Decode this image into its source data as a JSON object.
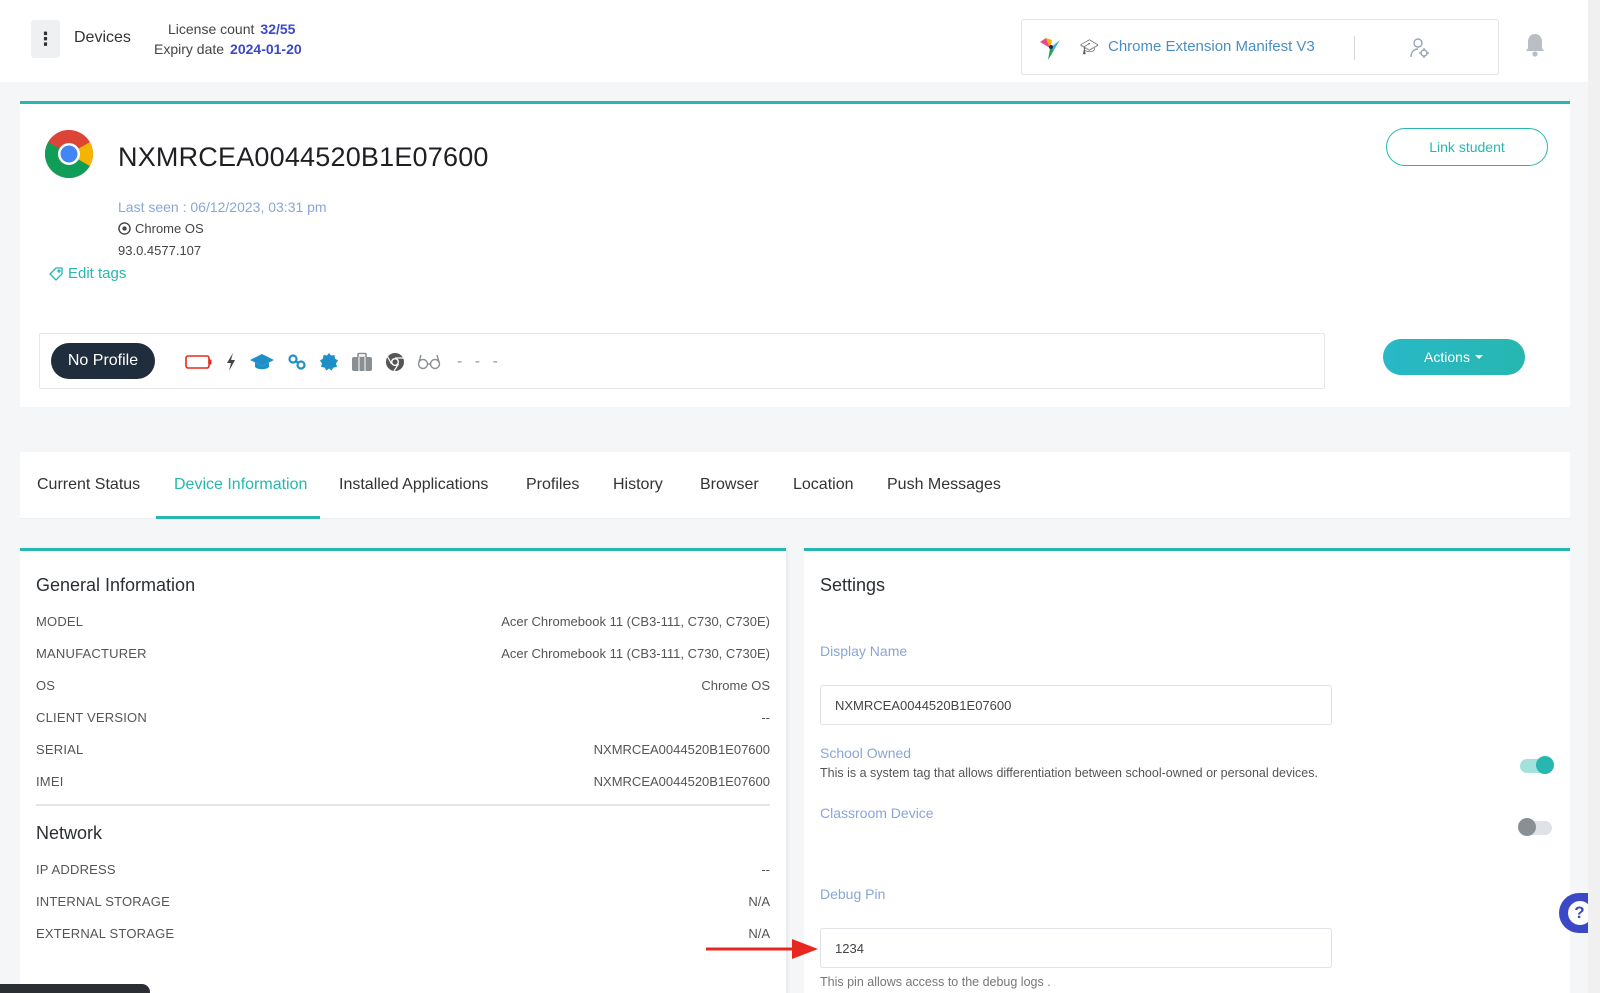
{
  "header": {
    "page_label": "Devices",
    "license_label": "License count",
    "license_value": "32/55",
    "expiry_label": "Expiry date",
    "expiry_value": "2024-01-20",
    "org_name": "Chrome Extension Manifest V3"
  },
  "device": {
    "title": "NXMRCEA0044520B1E07600",
    "last_seen": "Last seen : 06/12/2023, 03:31 pm",
    "os": "Chrome OS",
    "version": "93.0.4577.107",
    "edit_tags": "Edit tags",
    "link_student": "Link student",
    "profile": "No Profile",
    "status_dashes": "- - -",
    "actions": "Actions"
  },
  "tabs": [
    {
      "label": "Current Status"
    },
    {
      "label": "Device Information"
    },
    {
      "label": "Installed Applications"
    },
    {
      "label": "Profiles"
    },
    {
      "label": "History"
    },
    {
      "label": "Browser"
    },
    {
      "label": "Location"
    },
    {
      "label": "Push Messages"
    }
  ],
  "general": {
    "title": "General Information",
    "rows": [
      {
        "k": "MODEL",
        "v": "Acer Chromebook 11 (CB3-111, C730, C730E)"
      },
      {
        "k": "MANUFACTURER",
        "v": "Acer Chromebook 11 (CB3-111, C730, C730E)"
      },
      {
        "k": "OS",
        "v": "Chrome OS"
      },
      {
        "k": "CLIENT VERSION",
        "v": "--"
      },
      {
        "k": "SERIAL",
        "v": "NXMRCEA0044520B1E07600"
      },
      {
        "k": "IMEI",
        "v": "NXMRCEA0044520B1E07600"
      }
    ]
  },
  "network": {
    "title": "Network",
    "rows": [
      {
        "k": "IP ADDRESS",
        "v": "--"
      },
      {
        "k": "INTERNAL STORAGE",
        "v": "N/A"
      },
      {
        "k": "EXTERNAL STORAGE",
        "v": "N/A"
      }
    ]
  },
  "settings": {
    "title": "Settings",
    "display_name_label": "Display Name",
    "display_name_value": "NXMRCEA0044520B1E07600",
    "school_owned_label": "School Owned",
    "school_owned_help": "This is a system tag that allows differentiation between school-owned or personal devices.",
    "classroom_label": "Classroom Device",
    "debug_label": "Debug Pin",
    "debug_value": "1234",
    "debug_help": "This pin allows access to the debug logs ."
  },
  "colors": {
    "accent": "#27b7b0",
    "link_blue": "#3b49c7",
    "profile_pill": "#1f2d3d",
    "annotation_arrow": "#e8281e"
  }
}
